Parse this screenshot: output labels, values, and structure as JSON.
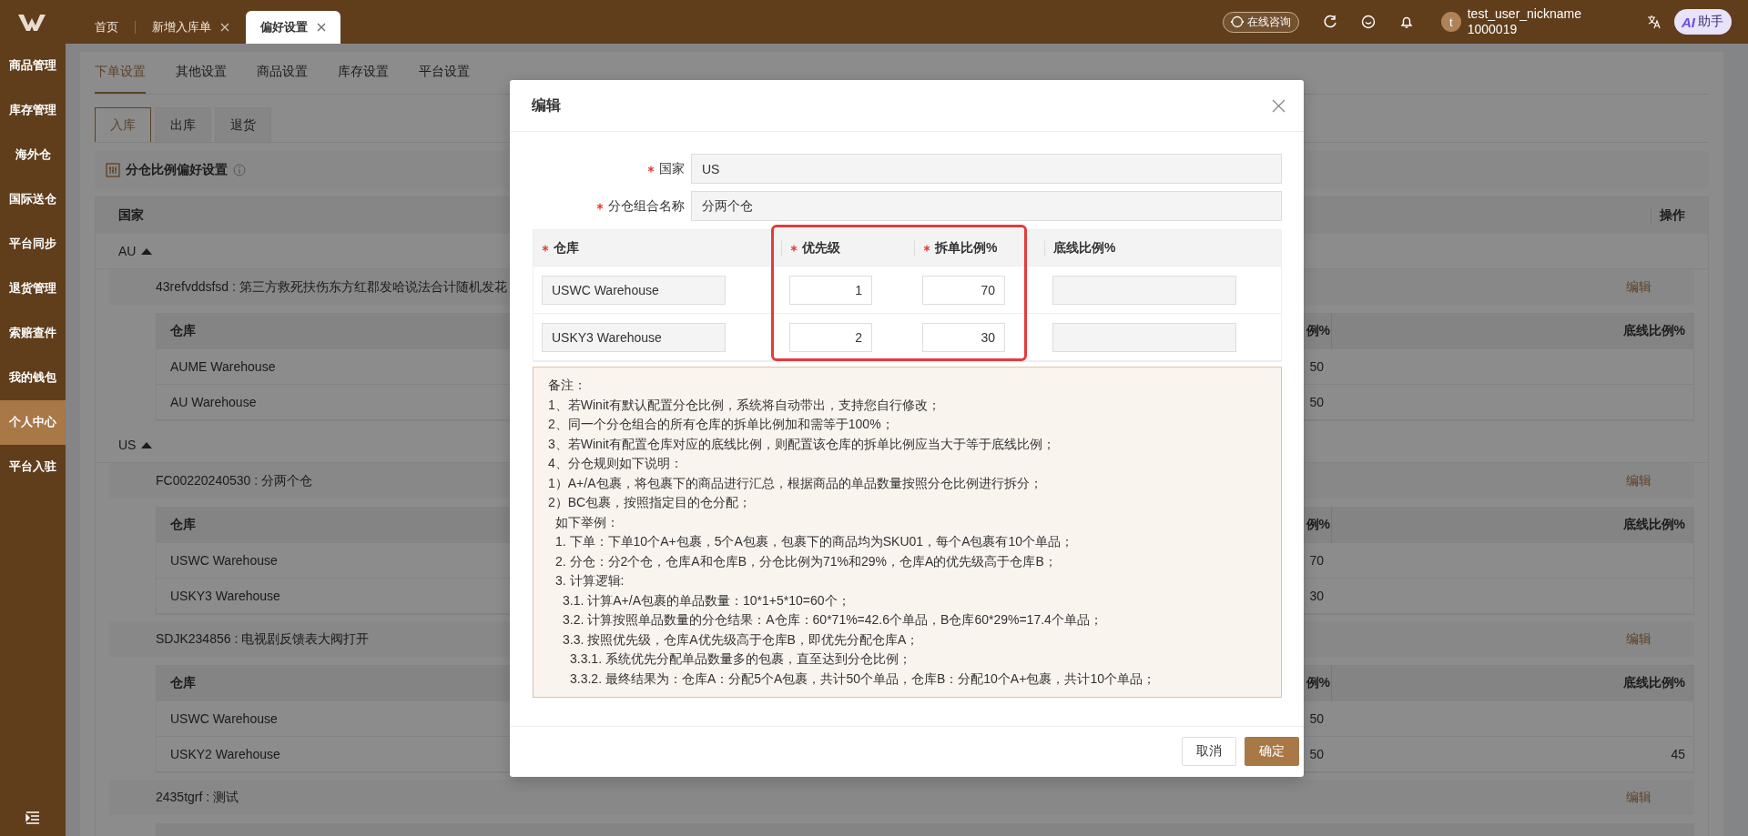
{
  "top_tabs": [
    {
      "label": "首页",
      "closable": false,
      "selected": false
    },
    {
      "label": "新增入库单",
      "closable": true,
      "selected": false
    },
    {
      "label": "偏好设置",
      "closable": true,
      "selected": true
    }
  ],
  "header": {
    "consult": "在线咨询",
    "user_initial": "t",
    "user_name": "test_user_nickname",
    "user_id": "1000019",
    "assistant_badge": "AI",
    "assistant_label": "助手"
  },
  "sidebar": {
    "items": [
      {
        "label": "商品管理",
        "selected": false
      },
      {
        "label": "库存管理",
        "selected": false
      },
      {
        "label": "海外仓",
        "selected": false
      },
      {
        "label": "国际送仓",
        "selected": false
      },
      {
        "label": "平台同步",
        "selected": false
      },
      {
        "label": "退货管理",
        "selected": false
      },
      {
        "label": "索赔查件",
        "selected": false
      },
      {
        "label": "我的钱包",
        "selected": false
      },
      {
        "label": "个人中心",
        "selected": true
      },
      {
        "label": "平台入驻",
        "selected": false
      }
    ]
  },
  "settings_tabs": [
    {
      "label": "下单设置",
      "selected": true
    },
    {
      "label": "其他设置",
      "selected": false
    },
    {
      "label": "商品设置",
      "selected": false
    },
    {
      "label": "库存设置",
      "selected": false
    },
    {
      "label": "平台设置",
      "selected": false
    }
  ],
  "direction_tabs": [
    {
      "label": "入库",
      "selected": true
    },
    {
      "label": "出库",
      "selected": false
    },
    {
      "label": "退货",
      "selected": false
    }
  ],
  "section_title": "分仓比例偏好设置",
  "table": {
    "columns": [
      "国家",
      "操作"
    ],
    "countries": [
      {
        "name": "AU",
        "expanded": true,
        "groups": [
          {
            "title": "43refvddsfsd : 第三方救死扶伤东方红郡发哈说法合计随机发花",
            "action": "编辑",
            "headers": {
              "warehouse": "仓库",
              "split": "例%",
              "baseline": "底线比例%"
            },
            "rows": [
              {
                "warehouse": "AUME Warehouse",
                "split": "50"
              },
              {
                "warehouse": "AU Warehouse",
                "split": "50"
              }
            ]
          }
        ]
      },
      {
        "name": "US",
        "expanded": true,
        "groups": [
          {
            "title": "FC00220240530 : 分两个仓",
            "action": "编辑",
            "headers": {
              "warehouse": "仓库",
              "split": "例%",
              "baseline": "底线比例%"
            },
            "rows": [
              {
                "warehouse": "USWC Warehouse",
                "split": "70"
              },
              {
                "warehouse": "USKY3 Warehouse",
                "split": "30"
              }
            ]
          },
          {
            "title": "SDJK234856 : 电视剧反馈表大阀打开",
            "action": "编辑",
            "headers": {
              "warehouse": "仓库",
              "split": "例%",
              "baseline": "底线比例%"
            },
            "rows": [
              {
                "warehouse": "USWC Warehouse",
                "split": "50"
              },
              {
                "warehouse": "USKY2 Warehouse",
                "split": "50",
                "baseline": "45"
              }
            ]
          },
          {
            "title": "2435tgrf : 测试",
            "action": "编辑"
          }
        ]
      }
    ]
  },
  "dialog": {
    "title": "编辑",
    "fields": [
      {
        "label": "国家",
        "required": true,
        "value": "US"
      },
      {
        "label": "分仓组合名称",
        "required": true,
        "value": "分两个仓"
      }
    ],
    "table": {
      "columns": [
        {
          "label": "仓库",
          "required": true,
          "highlighted": false
        },
        {
          "label": "优先级",
          "required": true,
          "highlighted": true
        },
        {
          "label": "拆单比例%",
          "required": true,
          "highlighted": true
        },
        {
          "label": "底线比例%",
          "required": false,
          "highlighted": false
        }
      ],
      "rows": [
        {
          "warehouse": "USWC Warehouse",
          "priority": "1",
          "split": "70"
        },
        {
          "warehouse": "USKY3 Warehouse",
          "priority": "2",
          "split": "30"
        }
      ]
    },
    "notes": [
      {
        "text": "备注："
      },
      {
        "text": "1、若Winit有默认配置分仓比例，系统将自动带出，支持您自行修改；"
      },
      {
        "text": "2、同一个分仓组合的所有仓库的拆单比例加和需等于100%；"
      },
      {
        "text": "3、若Winit有配置仓库对应的底线比例，则配置该仓库的拆单比例应当大于等于底线比例；"
      },
      {
        "text": "4、分仓规则如下说明："
      },
      {
        "text": "1）A+/A包裹，将包裹下的商品进行汇总，根据商品的单品数量按照分仓比例进行拆分；"
      },
      {
        "text": "2）BC包裹，按照指定目的仓分配；"
      }
    ],
    "example": {
      "heading": "如下举例：",
      "steps": [
        {
          "text": "1. 下单：下单10个A+包裹，5个A包裹，包裹下的商品均为SKU01，每个A包裹有10个单品；"
        },
        {
          "text": "2. 分仓：分2个仓，仓库A和仓库B，分仓比例为71%和29%，仓库A的优先级高于仓库B；"
        },
        {
          "text": "3. 计算逻辑:",
          "children": [
            {
              "text": "3.1. 计算A+/A包裹的单品数量：10*1+5*10=60个；"
            },
            {
              "text": "3.2. 计算按照单品数量的分仓结果：A仓库：60*71%=42.6个单品，B仓库60*29%=17.4个单品；"
            },
            {
              "text": "3.3. 按照优先级，仓库A优先级高于仓库B，即优先分配仓库A；",
              "children": [
                {
                  "text": "3.3.1. 系统优先分配单品数量多的包裹，直至达到分仓比例；"
                },
                {
                  "text": "3.3.2. 最终结果为：仓库A：分配5个A包裹，共计50个单品，仓库B：分配10个A+包裹，共计10个单品；"
                }
              ]
            }
          ]
        }
      ]
    },
    "buttons": [
      {
        "label": "取消",
        "kind": "secondary"
      },
      {
        "label": "确定",
        "kind": "primary"
      }
    ]
  }
}
